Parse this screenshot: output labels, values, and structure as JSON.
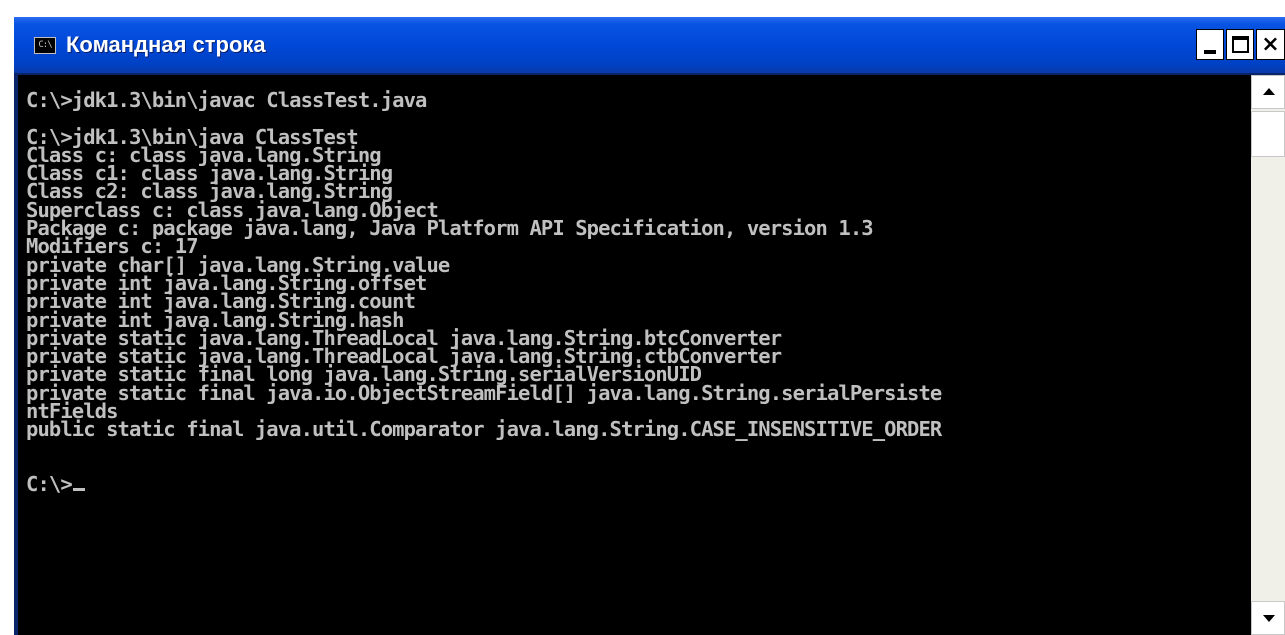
{
  "window": {
    "title": "Командная строка",
    "icon_text": "C:\\"
  },
  "console": {
    "lines": [
      "C:\\>jdk1.3\\bin\\javac ClassTest.java",
      "",
      "C:\\>jdk1.3\\bin\\java ClassTest",
      "Class c: class java.lang.String",
      "Class c1: class java.lang.String",
      "Class c2: class java.lang.String",
      "Superclass c: class java.lang.Object",
      "Package c: package java.lang, Java Platform API Specification, version 1.3",
      "Modifiers c: 17",
      "private char[] java.lang.String.value",
      "private int java.lang.String.offset",
      "private int java.lang.String.count",
      "private int java.lang.String.hash",
      "private static java.lang.ThreadLocal java.lang.String.btcConverter",
      "private static java.lang.ThreadLocal java.lang.String.ctbConverter",
      "private static final long java.lang.String.serialVersionUID",
      "private static final java.io.ObjectStreamField[] java.lang.String.serialPersiste",
      "ntFields",
      "public static final java.util.Comparator java.lang.String.CASE_INSENSITIVE_ORDER",
      "",
      "",
      "C:\\>"
    ]
  },
  "icons": {
    "app": "cmd-icon",
    "minimize": "minimize-icon",
    "maximize": "maximize-icon",
    "close": "close-icon",
    "scroll_up": "arrow-up-icon",
    "scroll_down": "arrow-down-icon"
  },
  "colors": {
    "titlebar": "#0048d8",
    "console_bg": "#000000",
    "console_fg": "#c0c0c0"
  }
}
